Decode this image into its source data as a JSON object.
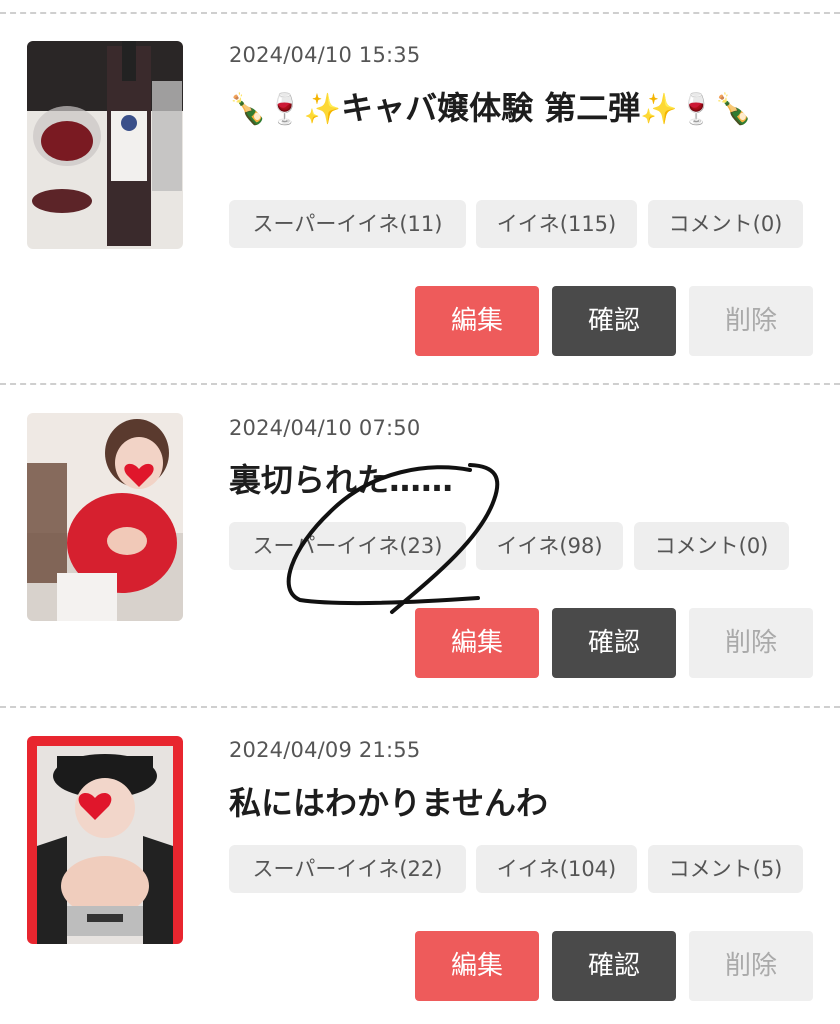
{
  "posts": [
    {
      "date": "2024/04/10 15:35",
      "title_prefix": "🍾🍷✨",
      "title_text": "キャバ嬢体験 第二弾",
      "title_suffix": "✨🍷🍾",
      "super_like": "スーパーイイネ(11)",
      "like": "イイネ(115)",
      "comment": "コメント(0)",
      "edit": "編集",
      "confirm": "確認",
      "delete": "削除"
    },
    {
      "date": "2024/04/10 07:50",
      "title_text": "裏切られた……",
      "super_like": "スーパーイイネ(23)",
      "like": "イイネ(98)",
      "comment": "コメント(0)",
      "edit": "編集",
      "confirm": "確認",
      "delete": "削除"
    },
    {
      "date": "2024/04/09 21:55",
      "title_text": "私にはわかりませんわ",
      "super_like": "スーパーイイネ(22)",
      "like": "イイネ(104)",
      "comment": "コメント(5)",
      "edit": "編集",
      "confirm": "確認",
      "delete": "削除"
    }
  ],
  "colors": {
    "edit": "#ee5b5b",
    "confirm": "#4a4a4a",
    "delete": "#efefef",
    "chip": "#eeeeee"
  }
}
